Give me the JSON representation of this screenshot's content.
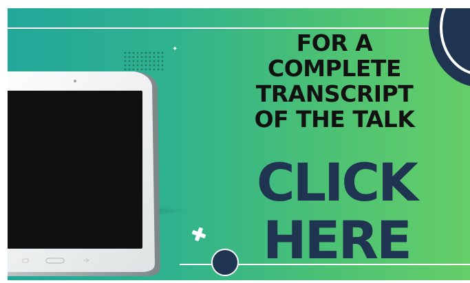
{
  "banner": {
    "headline_lines": [
      "FOR A",
      "COMPLETE",
      "TRANSCRIPT",
      "OF THE TALK"
    ],
    "cta_lines": [
      "CLICK",
      "HERE"
    ]
  },
  "colors": {
    "gradient_start": "#24a79a",
    "gradient_end": "#66ce68",
    "navy": "#1e3450",
    "headline_text": "#111111",
    "white": "#ffffff"
  },
  "icons": [
    "sparkle-icon",
    "plus-icon"
  ]
}
